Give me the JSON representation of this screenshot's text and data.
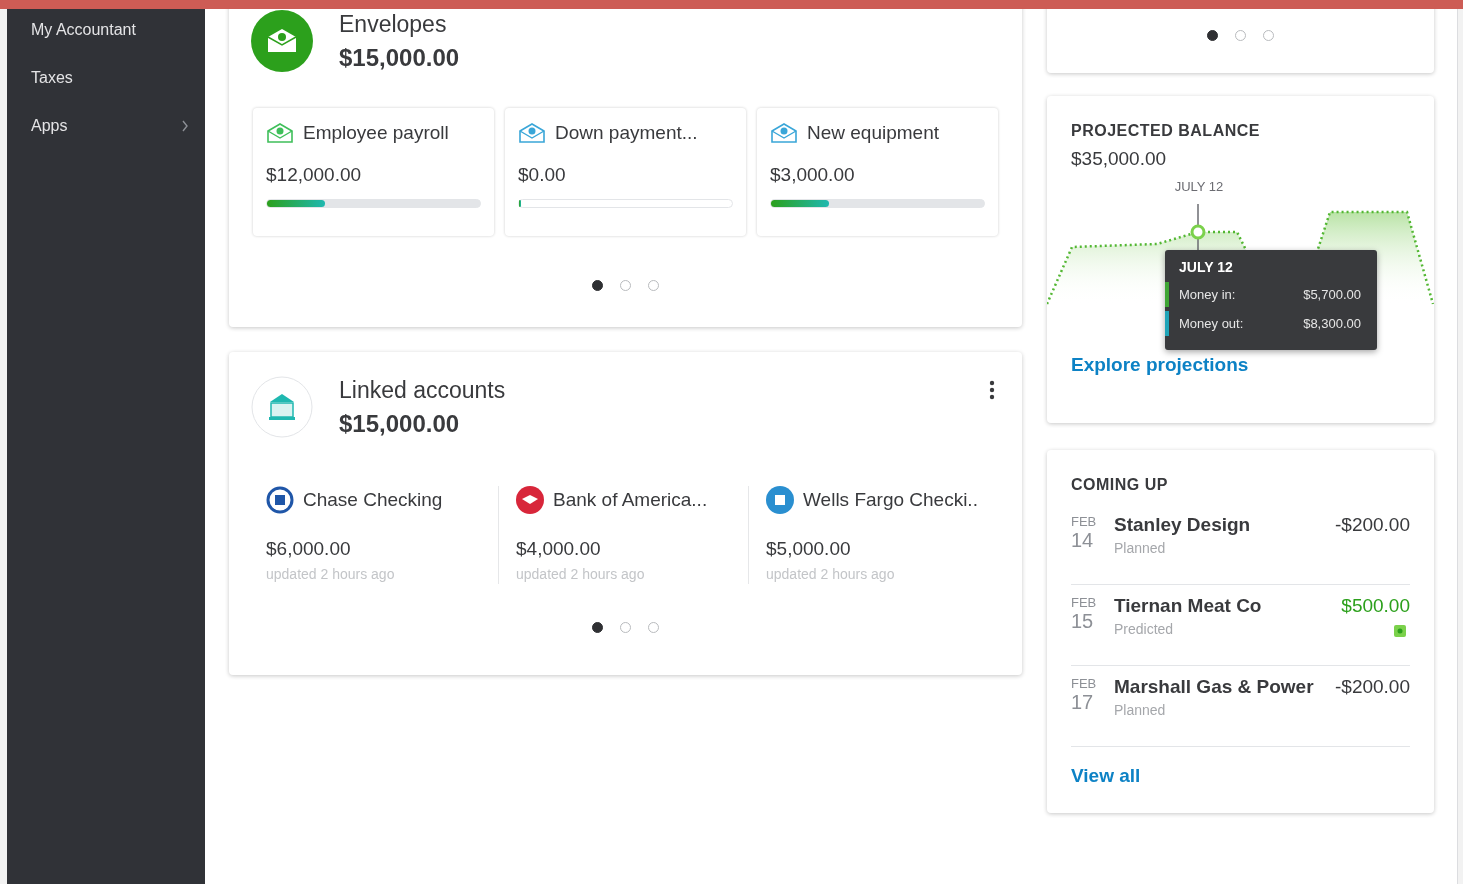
{
  "sidebar": {
    "items": [
      {
        "label": "My Accountant",
        "has_submenu": false
      },
      {
        "label": "Taxes",
        "has_submenu": false
      },
      {
        "label": "Apps",
        "has_submenu": true
      }
    ]
  },
  "top_card": {
    "dots": [
      {
        "selected": true
      },
      {
        "selected": false
      },
      {
        "selected": false
      }
    ]
  },
  "envelopes": {
    "title": "Envelopes",
    "total": "$15,000.00",
    "items": [
      {
        "name": "Employee payroll",
        "amount": "$12,000.00",
        "level": 0.27,
        "color": "#3fbf5a"
      },
      {
        "name": "Down payment...",
        "amount": "$0.00",
        "level": 0,
        "color": "#3aa6d8"
      },
      {
        "name": "New equipment",
        "amount": "$3,000.00",
        "level": 0.27,
        "color": "#3aa6d8"
      }
    ],
    "dots": [
      {
        "selected": true
      },
      {
        "selected": false
      },
      {
        "selected": false
      }
    ]
  },
  "linked_accounts": {
    "title": "Linked accounts",
    "total": "$15,000.00",
    "accounts": [
      {
        "name": "Chase Checking",
        "amount": "$6,000.00",
        "updated": "updated 2 hours ago",
        "kind": "ring",
        "color": "#1f56a8"
      },
      {
        "name": "Bank of America...",
        "amount": "$4,000.00",
        "updated": "updated 2 hours ago",
        "kind": "flag",
        "color": "#d8263a"
      },
      {
        "name": "Wells Fargo Checki..",
        "amount": "$5,000.00",
        "updated": "updated 2 hours ago",
        "kind": "bank",
        "color": "#2a8fd0"
      }
    ],
    "dots": [
      {
        "selected": true
      },
      {
        "selected": false
      },
      {
        "selected": false
      }
    ]
  },
  "projected_balance": {
    "title": "PROJECTED BALANCE",
    "amount": "$35,000.00",
    "marker_label": "JULY 12",
    "tooltip": {
      "title": "JULY 12",
      "rows": [
        {
          "label": "Money in:",
          "value": "$5,700.00",
          "color": "#3fa535"
        },
        {
          "label": "Money out:",
          "value": "$8,300.00",
          "color": "#1fa4b8"
        }
      ]
    },
    "link": "Explore projections"
  },
  "coming_up": {
    "title": "COMING UP",
    "items": [
      {
        "month": "FEB",
        "day": "14",
        "name": "Stanley Design",
        "status": "Planned",
        "amount": "-$200.00",
        "kind": "expense",
        "predicted_icon": false
      },
      {
        "month": "FEB",
        "day": "15",
        "name": "Tiernan Meat Co",
        "status": "Predicted",
        "amount": "$500.00",
        "kind": "income",
        "predicted_icon": true
      },
      {
        "month": "FEB",
        "day": "17",
        "name": "Marshall Gas & Power",
        "status": "Planned",
        "amount": "-$200.00",
        "kind": "expense",
        "predicted_icon": false
      }
    ],
    "link": "View all"
  }
}
